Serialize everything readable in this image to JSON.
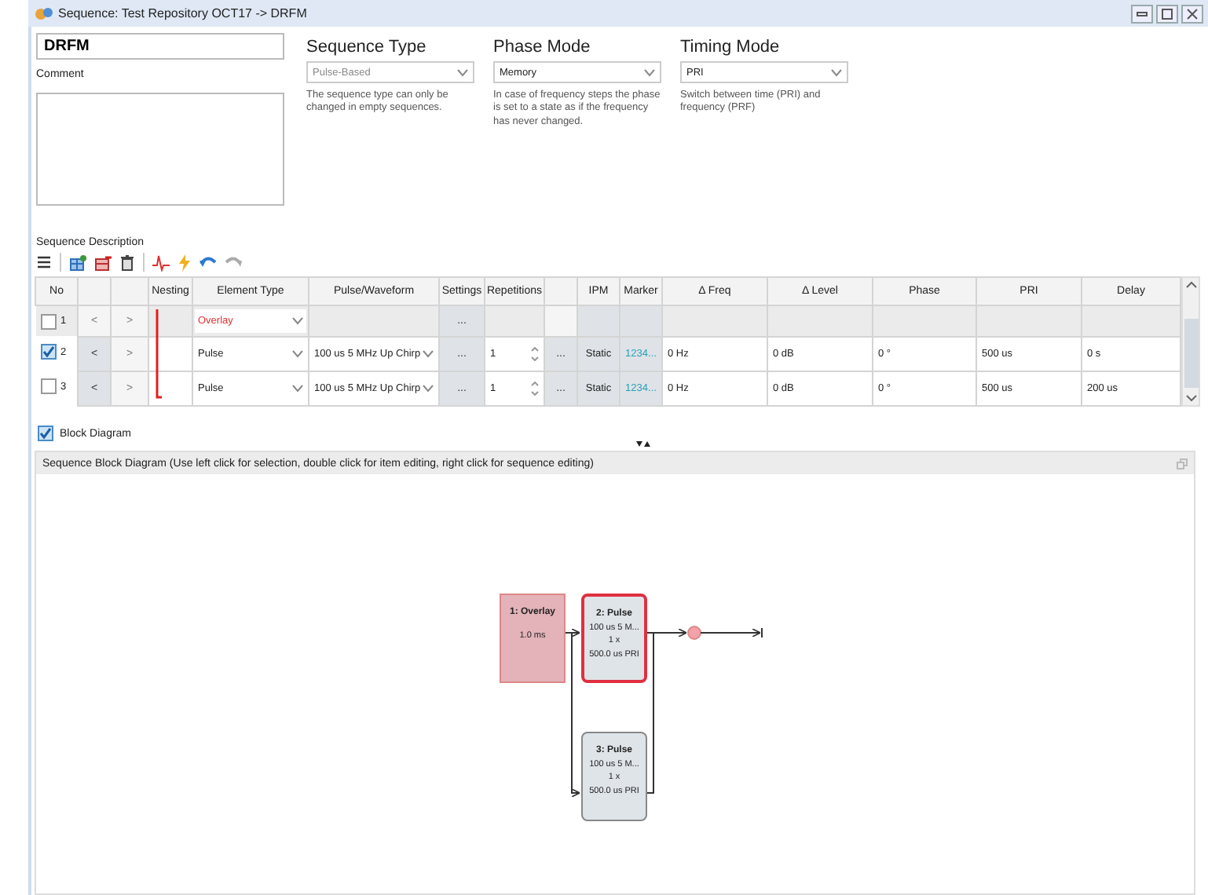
{
  "window": {
    "title": "Sequence: Test Repository OCT17 -> DRFM"
  },
  "name_field": {
    "value": "DRFM"
  },
  "comment": {
    "label": "Comment"
  },
  "modes": [
    {
      "heading": "Sequence Type",
      "value": "Pulse-Based",
      "disabled": true,
      "hint": "The sequence type can only be changed in empty sequences."
    },
    {
      "heading": "Phase Mode",
      "value": "Memory",
      "disabled": false,
      "hint": "In case of frequency steps the phase is set to a state as if the frequency has never changed."
    },
    {
      "heading": "Timing Mode",
      "value": "PRI",
      "disabled": false,
      "hint": "Switch between time (PRI) and frequency (PRF)"
    }
  ],
  "sequence_description": {
    "label": "Sequence Description"
  },
  "table": {
    "columns": [
      "No",
      "",
      "",
      "Nesting",
      "Element Type",
      "Pulse/Waveform",
      "Settings",
      "Repetitions",
      "",
      "IPM",
      "Marker",
      "Δ Freq",
      "Δ Level",
      "Phase",
      "PRI",
      "Delay"
    ],
    "rows": [
      {
        "kind": "overlay",
        "checked": false,
        "no": "1",
        "prev": "<",
        "next": ">",
        "element_type": "Overlay",
        "settings": "..."
      },
      {
        "kind": "pulse",
        "checked": true,
        "no": "2",
        "prev": "<",
        "next": ">",
        "element_type": "Pulse",
        "waveform": "100 us 5 MHz Up Chirp",
        "settings": "...",
        "repetitions": "1",
        "more": "...",
        "ipm": "Static",
        "marker": "1234...",
        "freq": "0 Hz",
        "level": "0 dB",
        "phase": "0 °",
        "pri": "500 us",
        "delay": "0 s"
      },
      {
        "kind": "pulse",
        "checked": false,
        "no": "3",
        "prev": "<",
        "next": ">",
        "element_type": "Pulse",
        "waveform": "100 us 5 MHz Up Chirp",
        "settings": "...",
        "repetitions": "1",
        "more": "...",
        "ipm": "Static",
        "marker": "1234...",
        "freq": "0 Hz",
        "level": "0 dB",
        "phase": "0 °",
        "pri": "500 us",
        "delay": "200 us"
      }
    ]
  },
  "block_diagram_toggle": {
    "label": "Block Diagram",
    "checked": true
  },
  "block_diagram": {
    "title": "Sequence Block Diagram (Use left click for selection, double click for item editing, right click for sequence editing)",
    "nodes": [
      {
        "kind": "overlay",
        "selected": false,
        "title": "1: Overlay",
        "lines": [
          "1.0 ms"
        ]
      },
      {
        "kind": "pulse",
        "selected": true,
        "title": "2: Pulse",
        "lines": [
          "100 us 5 M...",
          "1 x",
          "500.0 us PRI"
        ]
      },
      {
        "kind": "pulse",
        "selected": false,
        "title": "3: Pulse",
        "lines": [
          "100 us 5 M...",
          "1 x",
          "500.0 us PRI"
        ]
      }
    ]
  }
}
